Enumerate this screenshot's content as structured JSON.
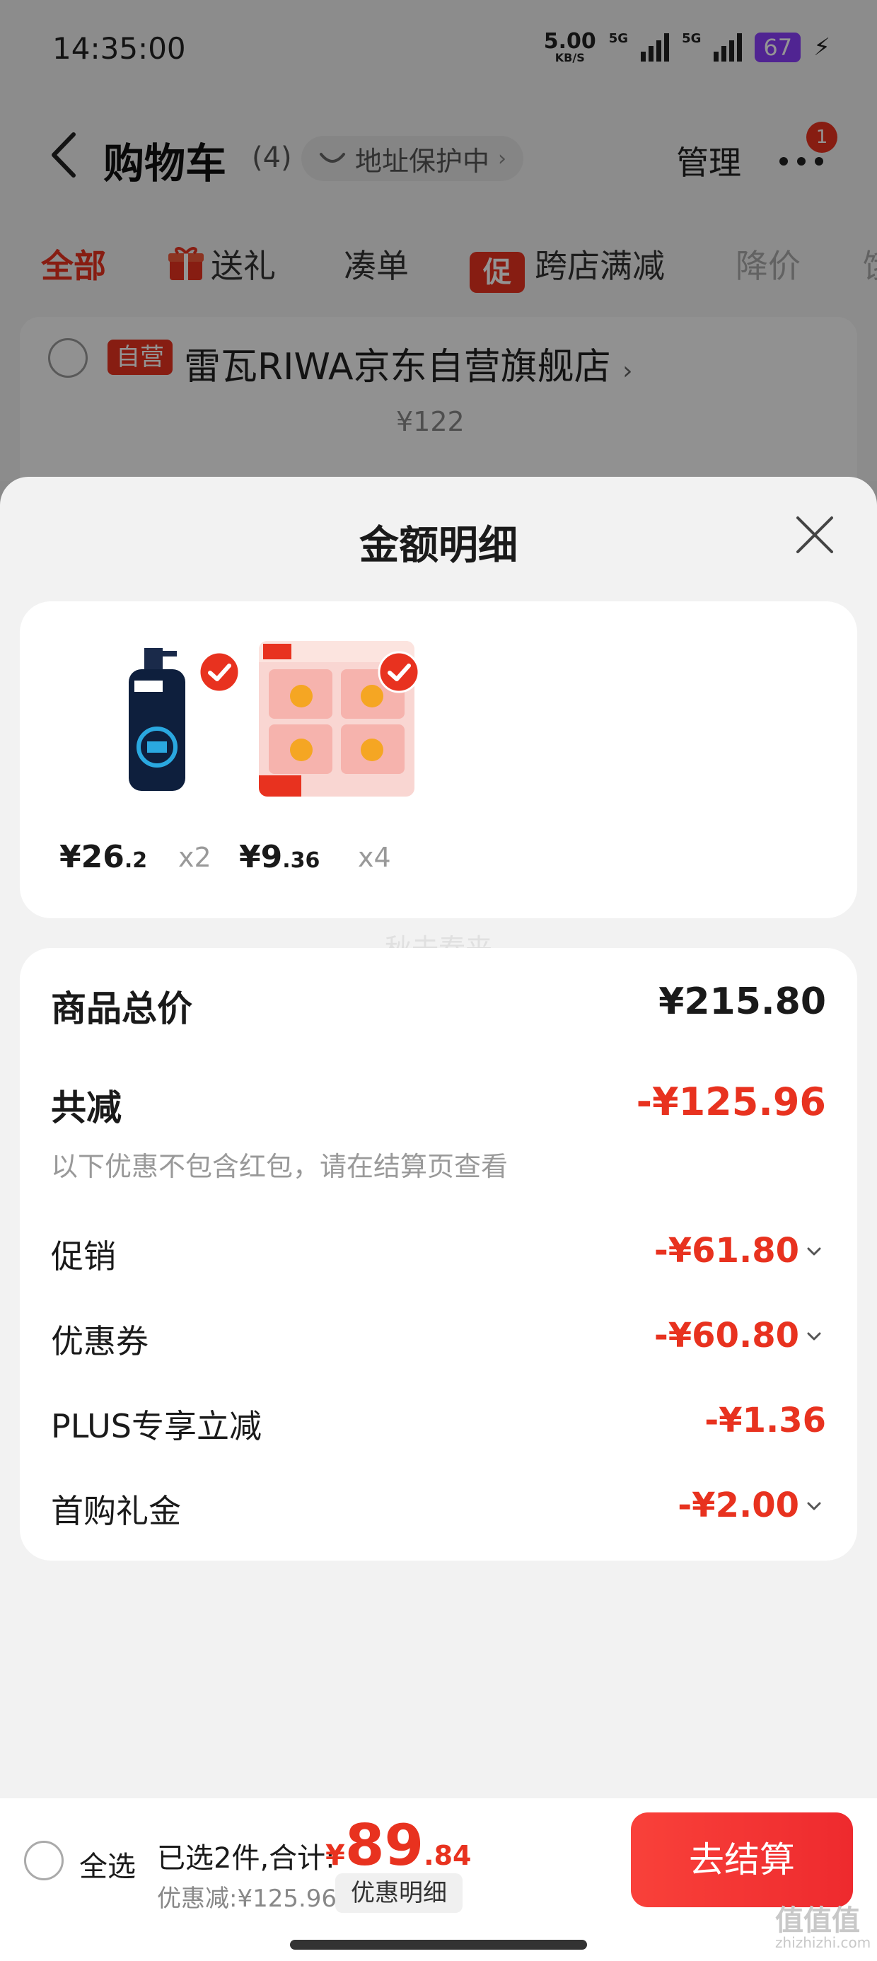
{
  "status_bar": {
    "time": "14:35:00",
    "net_speed": "5.00",
    "net_unit": "KB/S",
    "signal1": "5G",
    "signal2": "5G",
    "battery": "67"
  },
  "header": {
    "title": "购物车",
    "count": "(4)",
    "address_protection": "地址保护中",
    "manage": "管理",
    "notification_badge": "1"
  },
  "tabs": [
    {
      "label": "全部"
    },
    {
      "label": "送礼"
    },
    {
      "label": "凑单"
    },
    {
      "label": "跨店满减",
      "tag": "促"
    },
    {
      "label": "降价"
    },
    {
      "label": "饿"
    }
  ],
  "store": {
    "tag": "自营",
    "name": "雷瓦RIWA京东自营旗舰店",
    "price": "¥122"
  },
  "sheet": {
    "title": "金额明细",
    "products": [
      {
        "price_int": "¥26",
        "price_dec": ".2",
        "qty": "x2",
        "image": "shampoo-bottle"
      },
      {
        "price_int": "¥9",
        "price_dec": ".36",
        "qty": "x4",
        "image": "fragrance-pack"
      }
    ],
    "watermark": "秋去春来",
    "summary": {
      "total_label": "商品总价",
      "total_value": "¥215.80",
      "discount_label": "共减",
      "discount_value": "-¥125.96",
      "hint": "以下优惠不包含红包，请在结算页查看",
      "items": [
        {
          "label": "促销",
          "value": "-¥61.80",
          "expandable": true
        },
        {
          "label": "优惠券",
          "value": "-¥60.80",
          "expandable": true
        },
        {
          "label": "PLUS专享立减",
          "value": "-¥1.36",
          "expandable": false
        },
        {
          "label": "首购礼金",
          "value": "-¥2.00",
          "expandable": true
        }
      ]
    }
  },
  "footer": {
    "select_all": "全选",
    "selected_text": "已选2件,合计:",
    "total_currency": "¥",
    "total_int": "89",
    "total_dec": ".84",
    "saved_text": "优惠减:¥125.96",
    "detail_button": "优惠明细",
    "checkout_button": "去结算",
    "corner_watermark": "值值值",
    "corner_watermark_sub": "zhizhizhi.com"
  },
  "colors": {
    "accent": "#e8321f",
    "battery": "#8a3ffc",
    "sheet_bg": "#f2f2f2"
  }
}
